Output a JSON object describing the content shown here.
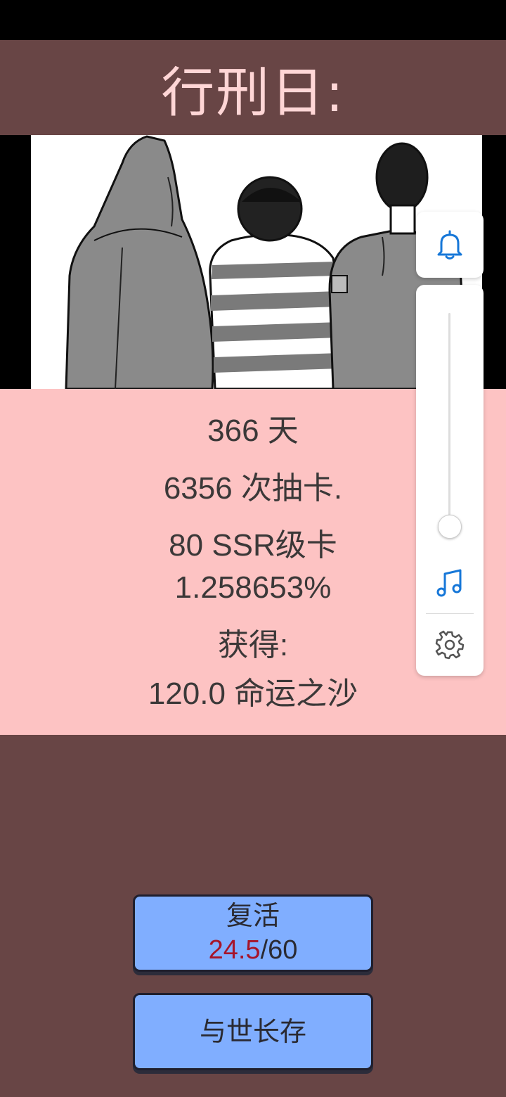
{
  "header": {
    "title": "行刑日:"
  },
  "stats": {
    "days": "366 天",
    "draws": "6356 次抽卡.",
    "ssr": "80 SSR级卡",
    "rate": "1.258653%",
    "gain_label": "获得:",
    "gain_value": "120.0 命运之沙"
  },
  "buttons": {
    "revive": {
      "label": "复活",
      "current": "24.5",
      "total": "/60"
    },
    "forever": {
      "label": "与世长存"
    }
  },
  "side_panel": {
    "icons": [
      "bell-icon",
      "music-note-icon",
      "gear-icon"
    ],
    "volume": 0.05,
    "accent": "#1677d8"
  },
  "colors": {
    "title_bg": "#684545",
    "title_text": "#ffd6d6",
    "stats_bg": "#fdc3c3",
    "button_bg": "#80aeff",
    "count_current": "#a6142a"
  }
}
